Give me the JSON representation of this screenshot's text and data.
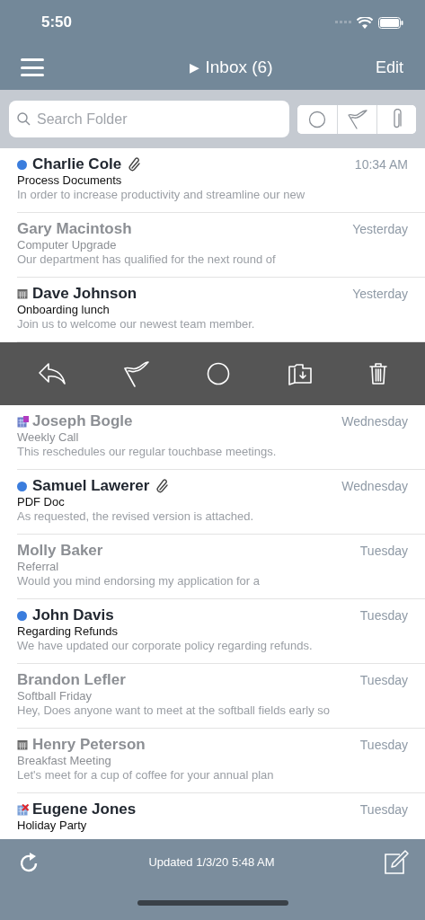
{
  "status_bar": {
    "time": "5:50"
  },
  "nav_bar": {
    "title_marker": "▶",
    "title": "Inbox (6)",
    "edit": "Edit"
  },
  "search": {
    "placeholder": "Search Folder"
  },
  "filters": [
    {
      "kind": "unread",
      "selected": false
    },
    {
      "kind": "flagged",
      "selected": false
    },
    {
      "kind": "attachment",
      "selected": false
    }
  ],
  "list": [
    {
      "kind": "message",
      "sender": "Charlie Cole",
      "unread": true,
      "marker": {
        "kind": "dot"
      },
      "attachment": true,
      "time": "10:34 AM",
      "subject": "Process Documents",
      "preview": "In order to increase productivity and streamline our new"
    },
    {
      "kind": "message",
      "sender": "Gary Macintosh",
      "unread": false,
      "attachment": false,
      "time": "Yesterday",
      "subject": "Computer Upgrade",
      "preview": "Our department has qualified for the next round of"
    },
    {
      "kind": "message",
      "sender": "Dave Johnson",
      "unread": true,
      "marker": {
        "kind": "calendar"
      },
      "attachment": false,
      "time": "Yesterday",
      "subject": "Onboarding lunch",
      "preview": "Join us to welcome our newest team member."
    },
    {
      "kind": "actions",
      "buttons": [
        {
          "kind": "reply"
        },
        {
          "kind": "flag"
        },
        {
          "kind": "mark"
        },
        {
          "kind": "move"
        },
        {
          "kind": "delete"
        }
      ]
    },
    {
      "kind": "message",
      "sender": "Joseph Bogle",
      "unread": false,
      "marker": {
        "kind": "meeting"
      },
      "attachment": false,
      "time": "Wednesday",
      "subject": "Weekly Call",
      "preview": "This reschedules our regular touchbase meetings."
    },
    {
      "kind": "message",
      "sender": "Samuel Lawerer",
      "unread": true,
      "marker": {
        "kind": "dot"
      },
      "attachment": true,
      "time": "Wednesday",
      "subject": "PDF Doc",
      "preview": "As requested, the revised version is attached."
    },
    {
      "kind": "message",
      "sender": "Molly Baker",
      "unread": false,
      "attachment": false,
      "time": "Tuesday",
      "subject": "Referral",
      "preview": "Would you mind endorsing my application for a"
    },
    {
      "kind": "message",
      "sender": "John Davis",
      "unread": true,
      "marker": {
        "kind": "dot"
      },
      "attachment": false,
      "time": "Tuesday",
      "subject": "Regarding Refunds",
      "preview": "We have updated our corporate policy regarding refunds."
    },
    {
      "kind": "message",
      "sender": "Brandon Lefler",
      "unread": false,
      "attachment": false,
      "time": "Tuesday",
      "subject": "Softball Friday",
      "preview": "Hey, Does anyone want to meet at the softball fields early so"
    },
    {
      "kind": "message",
      "sender": "Henry Peterson",
      "unread": false,
      "marker": {
        "kind": "calendar"
      },
      "attachment": false,
      "time": "Tuesday",
      "subject": "Breakfast Meeting",
      "preview": "Let's meet for a cup of coffee for your annual plan"
    },
    {
      "kind": "message",
      "sender": "Eugene Jones",
      "unread": true,
      "marker": {
        "kind": "cancelled"
      },
      "attachment": false,
      "time": "Tuesday",
      "subject": "Holiday Party"
    }
  ],
  "toolbar": {
    "status": "Updated 1/3/20 5:48 AM"
  }
}
